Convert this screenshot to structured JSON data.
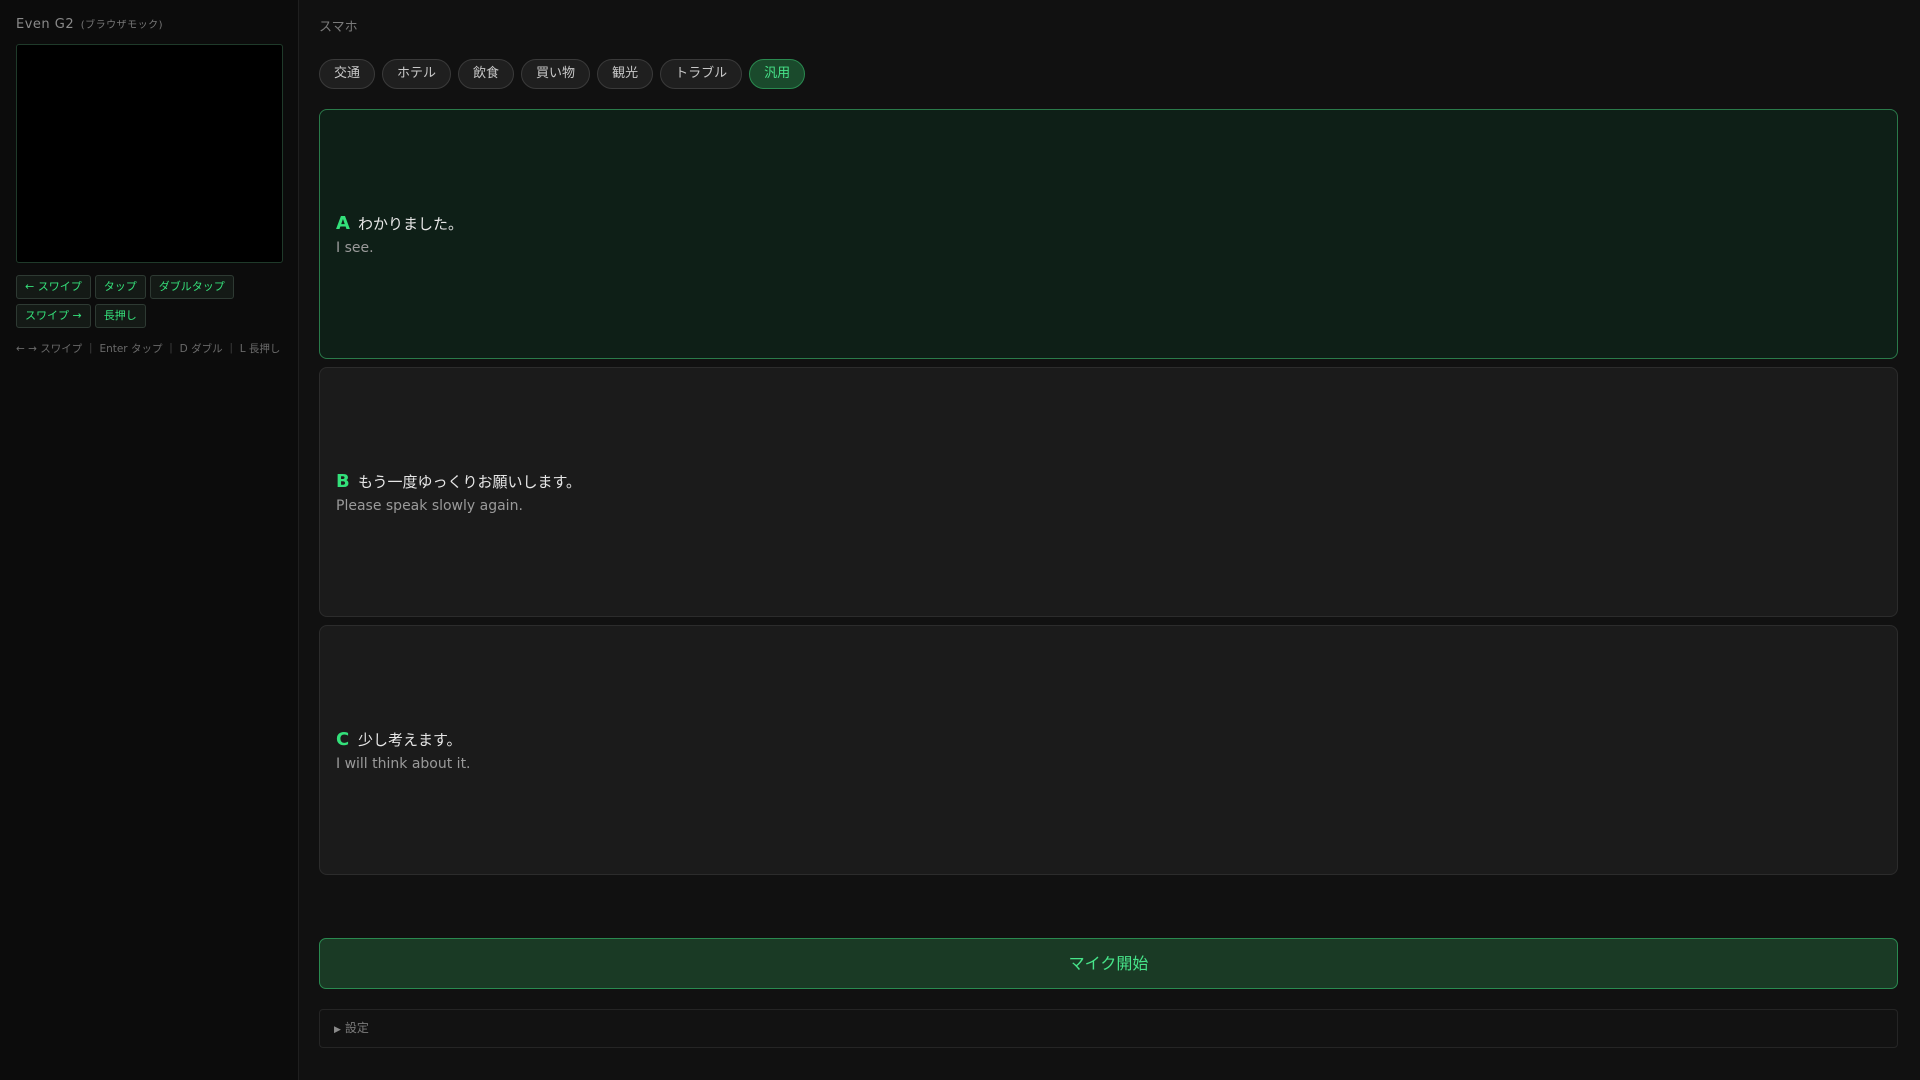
{
  "sidebar": {
    "title": "Even G2",
    "subtitle": "(ブラウザモック)",
    "buttons": [
      {
        "label": "← スワイプ"
      },
      {
        "label": "タップ"
      },
      {
        "label": "ダブルタップ"
      },
      {
        "label": "スワイプ →"
      },
      {
        "label": "長押し"
      }
    ],
    "hint": "← → スワイプ ｜ Enter タップ ｜ D ダブル ｜ L 長押し"
  },
  "main": {
    "breadcrumb": "スマホ",
    "categories": [
      {
        "label": "交通",
        "active": false
      },
      {
        "label": "ホテル",
        "active": false
      },
      {
        "label": "飲食",
        "active": false
      },
      {
        "label": "買い物",
        "active": false
      },
      {
        "label": "観光",
        "active": false
      },
      {
        "label": "トラブル",
        "active": false
      },
      {
        "label": "汎用",
        "active": true
      }
    ],
    "phrases": [
      {
        "letter": "A",
        "ja": "わかりました。",
        "en": "I see.",
        "selected": true
      },
      {
        "letter": "B",
        "ja": "もう一度ゆっくりお願いします。",
        "en": "Please speak slowly again.",
        "selected": false
      },
      {
        "letter": "C",
        "ja": "少し考えます。",
        "en": "I will think about it.",
        "selected": false
      }
    ],
    "mic_button": "マイク開始",
    "settings_label": "設定"
  },
  "colors": {
    "accent": "#33e07a",
    "selected_bg": "#0e1f17",
    "background": "#111111"
  },
  "icons": {
    "settings_toggle": "triangle-right-icon"
  }
}
